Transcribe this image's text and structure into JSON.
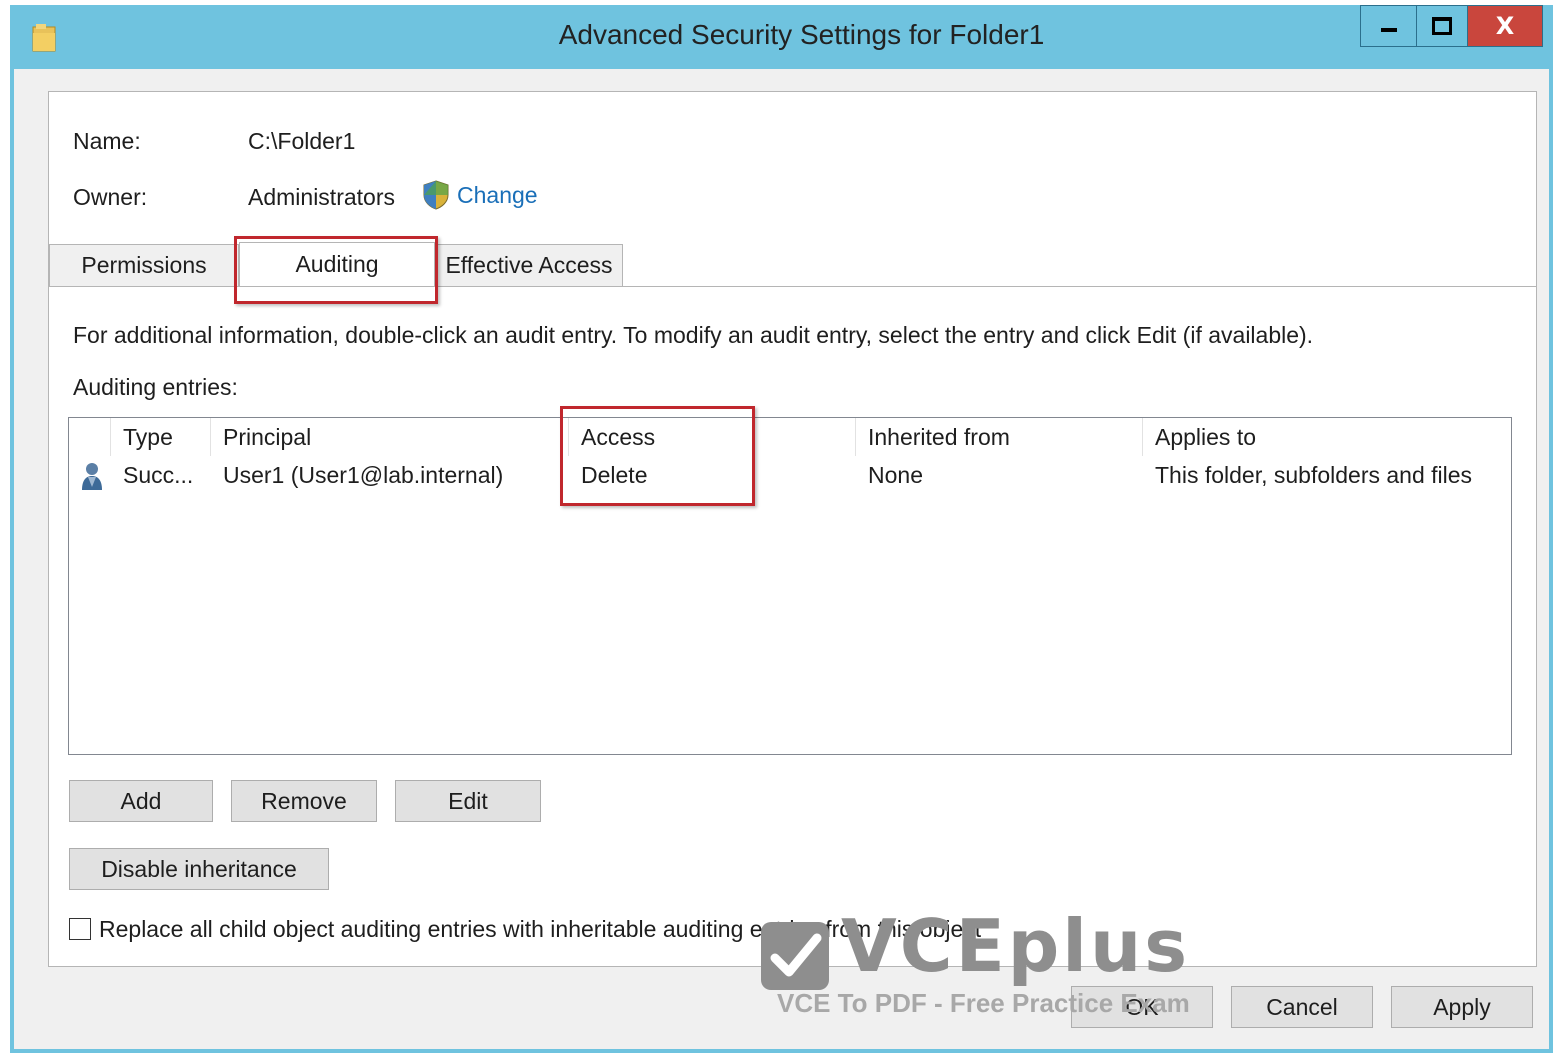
{
  "window": {
    "title": "Advanced Security Settings for Folder1",
    "controls": {
      "minimize": "—",
      "maximize": "□",
      "close": "X"
    }
  },
  "object": {
    "name_label": "Name:",
    "name_value": "C:\\Folder1",
    "owner_label": "Owner:",
    "owner_value": "Administrators",
    "change_link": "Change"
  },
  "tabs": [
    {
      "label": "Permissions",
      "active": false
    },
    {
      "label": "Auditing",
      "active": true
    },
    {
      "label": "Effective Access",
      "active": false
    }
  ],
  "auditing": {
    "info_text": "For additional information, double-click an audit entry. To modify an audit entry, select the entry and click Edit (if available).",
    "entries_label": "Auditing entries:",
    "columns": [
      "Type",
      "Principal",
      "Access",
      "Inherited from",
      "Applies to"
    ],
    "rows": [
      {
        "type": "Succ...",
        "principal": "User1 (User1@lab.internal)",
        "access": "Delete",
        "inherited_from": "None",
        "applies_to": "This folder, subfolders and files"
      }
    ]
  },
  "buttons": {
    "add": "Add",
    "remove": "Remove",
    "edit": "Edit",
    "disable_inheritance": "Disable inheritance",
    "ok": "OK",
    "cancel": "Cancel",
    "apply": "Apply"
  },
  "replace_checkbox": {
    "label": "Replace all child object auditing entries with inheritable auditing entries from this object",
    "checked": false
  },
  "watermark": {
    "brand": "VCEplus",
    "tagline": "VCE To PDF - Free Practice Exam"
  },
  "colors": {
    "titlebar": "#6fc3df",
    "highlight": "#c0272d",
    "link": "#1a6fb8",
    "close_button": "#c9463d"
  }
}
